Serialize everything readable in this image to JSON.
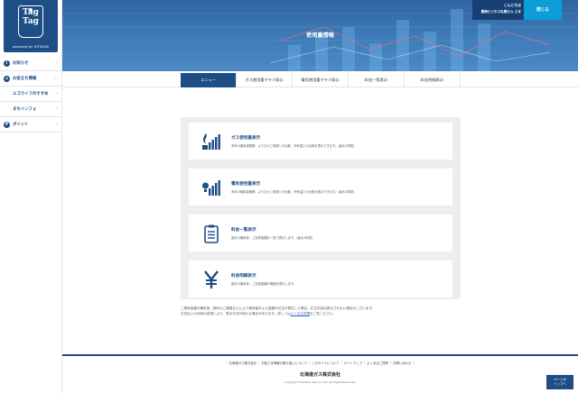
{
  "logo": {
    "name": "Tag\nTag",
    "tagline": "powered by HITAGAS"
  },
  "sidebar": {
    "items": [
      {
        "icon": "info-icon",
        "glyph": "i",
        "label": "お知らせ",
        "sub": false,
        "arrow": "›"
      },
      {
        "icon": "home-icon",
        "glyph": "⌂",
        "label": "お役立ち情報",
        "sub": false,
        "arrow": "−"
      },
      {
        "icon": "",
        "glyph": "",
        "label": "エコライフのすすめ",
        "sub": true,
        "arrow": "›"
      },
      {
        "icon": "",
        "glyph": "",
        "label": "まちインフォ",
        "sub": true,
        "arrow": "›"
      },
      {
        "icon": "point-icon",
        "glyph": "P",
        "label": "ポイント",
        "sub": false,
        "arrow": "›"
      }
    ]
  },
  "header": {
    "title": "使用量情報",
    "greeting": "こんにちは",
    "user_name": "夏刷ビジネス札幌ビル さま",
    "close_label": "閉じる"
  },
  "tabs": [
    {
      "label": "メニュー",
      "active": true
    },
    {
      "label": "ガス使用量グラフ表示",
      "active": false
    },
    {
      "label": "電気使用量グラフ表示",
      "active": false
    },
    {
      "label": "料金一覧表示",
      "active": false
    },
    {
      "label": "料金明細表示",
      "active": false
    }
  ],
  "menu": [
    {
      "icon": "gas-flame-chart-icon",
      "title": "ガス使用量表示",
      "desc": "本年の使用量推移、よりむかご家族との比較、外気温との比較を表示できます。(最大2年間)"
    },
    {
      "icon": "bulb-chart-icon",
      "title": "電気使用量表示",
      "desc": "本年の使用量推移、よりむかご家族との比較、外気温との比較を表示できます。(最大2年間)"
    },
    {
      "icon": "clipboard-list-icon",
      "title": "料金一覧表示",
      "desc": "各月の使用量・ご請求金額を一覧で表示します。(最大2年間)"
    },
    {
      "icon": "yen-icon",
      "title": "料金明細表示",
      "desc": "各月の使用量・ご請求金額の明細を表示します。"
    }
  ],
  "notice": {
    "line1": "ご請求金額の確定後、検針のご連絡などにより使用量および金額の訂正が発生した場合、訂正内容は表示されない場合がございます。",
    "line2_pre": "お支払いの手続の変更により、表示方法が変わる場合があります。詳しくは",
    "link": "よくある質問",
    "line2_post": "をご覧ください。"
  },
  "footer": {
    "links": [
      "北海道ガス株式会社",
      "お客さま情報の取り扱いについて",
      "このサイトについて",
      "サイトマップ",
      "よくあるご質問",
      "お問い合わせ"
    ],
    "company": "北海道ガス株式会社",
    "copyright": "Copyright Hokkaido Gas Co.,Ltd. All Rights Reserved.",
    "pagetop": "ページの\nトップへ"
  },
  "colors": {
    "brand": "#1f4e86",
    "accent": "#0c9ed9",
    "panel": "#eeeeee"
  }
}
